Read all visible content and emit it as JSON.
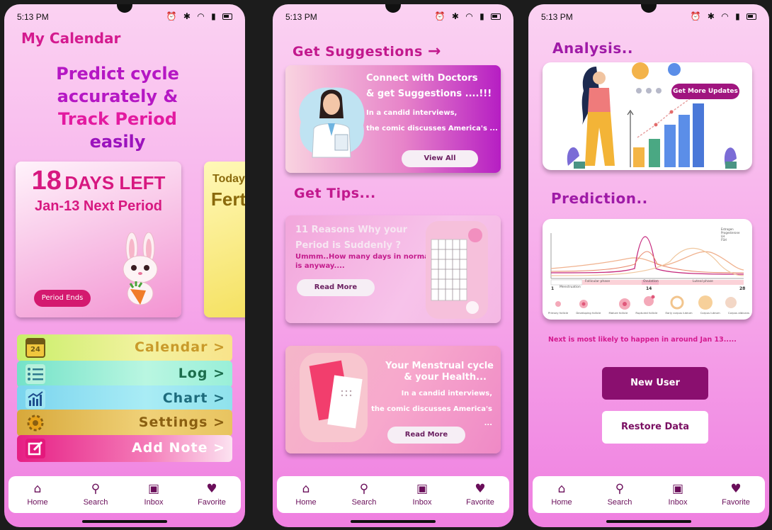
{
  "status": {
    "time": "5:13 PM"
  },
  "nav": [
    {
      "label": "Home",
      "icon": "home-icon"
    },
    {
      "label": "Search",
      "icon": "search-icon"
    },
    {
      "label": "Inbox",
      "icon": "inbox-icon"
    },
    {
      "label": "Favorite",
      "icon": "heart-icon"
    }
  ],
  "screen1": {
    "title": "My Calendar",
    "hero": [
      "Predict cycle",
      "accurately &",
      "Track Period",
      "easily"
    ],
    "days_card": {
      "days": "18",
      "days_label": "DAYS LEFT",
      "next": "Jan-13 Next Period",
      "button": "Period Ends"
    },
    "fertile_card": {
      "today": "Today",
      "fertile": "Fert"
    },
    "menu": [
      {
        "label": "Calendar >",
        "icon": "calendar-icon",
        "badge": "24"
      },
      {
        "label": "Log >",
        "icon": "list-icon"
      },
      {
        "label": "Chart >",
        "icon": "chart-icon"
      },
      {
        "label": "Settings >",
        "icon": "gear-icon"
      },
      {
        "label": "Add Note >",
        "icon": "edit-icon"
      }
    ]
  },
  "screen2": {
    "suggest_title": "Get Suggestions",
    "doctor_card": {
      "heading1": "Connect with Doctors",
      "heading2": "& get Suggestions ....!!!",
      "line1": "In a candid interviews,",
      "line2": "the comic discusses America's ...",
      "button": "View All"
    },
    "tips_title": "Get Tips...",
    "tips_card": {
      "heading1": "11 Reasons Why your",
      "heading2": "Period is Suddenly ?",
      "line1": "Ummm..How many days in normal",
      "line2": "is anyway....",
      "button": "Read More"
    },
    "health_card": {
      "heading1": "Your Menstrual cycle",
      "heading2": "& your Health...",
      "line1": "In a candid interviews,",
      "line2": "the comic discusses America's ...",
      "button": "Read More"
    }
  },
  "screen3": {
    "analysis_title": "Analysis..",
    "update_button": "Get More Updates",
    "prediction_title": "Prediction..",
    "chart_labels": {
      "phase1": "Follicular phase",
      "phase2": "Ovulation",
      "phase3": "Luteal phase",
      "menstruation": "Menstruation",
      "day_start": "1",
      "day_mid": "14",
      "day_end": "28",
      "legend": [
        "Estrogen",
        "Progesterone",
        "LH",
        "FSH"
      ],
      "stages": [
        "Primary follicle",
        "Developing follicle",
        "Mature follicle",
        "Ruptured follicle",
        "Early corpus luteum",
        "Corpus luteum",
        "Corpus albicans"
      ]
    },
    "next_text": "Next is most likely to happen in around  Jan 13.....",
    "new_user": "New User",
    "restore": "Restore Data"
  },
  "colors": {
    "accent": "#d41a8f",
    "nav": "#6a0e5a",
    "button_dark": "#8a0f6f"
  }
}
